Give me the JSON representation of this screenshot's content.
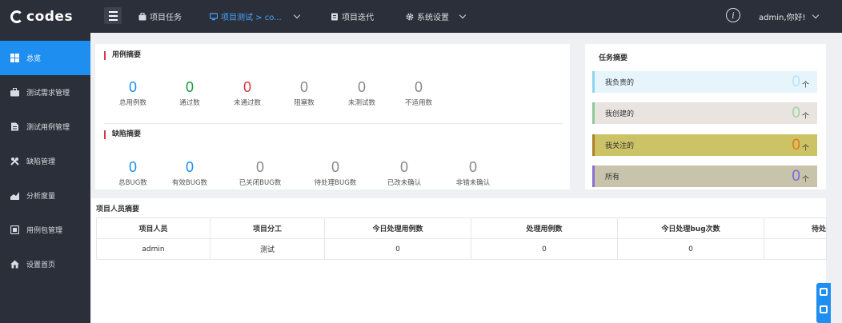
{
  "app": {
    "logo_text": "codes"
  },
  "topnav": {
    "items": [
      {
        "label": "项目任务",
        "icon": "briefcase-icon"
      },
      {
        "label": "项目测试 > co...",
        "icon": "monitor-icon",
        "active": true
      },
      {
        "label": "项目迭代",
        "icon": "document-icon"
      },
      {
        "label": "系统设置",
        "icon": "gear-icon"
      }
    ],
    "user_label": "admin,你好!"
  },
  "sidebar": {
    "items": [
      {
        "label": "总览",
        "icon": "dashboard-icon",
        "active": true
      },
      {
        "label": "测试需求管理",
        "icon": "briefcase-icon"
      },
      {
        "label": "测试用例管理",
        "icon": "file-icon"
      },
      {
        "label": "缺陷管理",
        "icon": "tools-icon"
      },
      {
        "label": "分析度量",
        "icon": "chart-icon"
      },
      {
        "label": "用例包管理",
        "icon": "package-icon"
      },
      {
        "label": "设置首页",
        "icon": "home-icon"
      }
    ]
  },
  "case_summary": {
    "title": "用例摘要",
    "stats": [
      {
        "value": "0",
        "label": "总用例数",
        "color": "#1f8ef1"
      },
      {
        "value": "0",
        "label": "通过数",
        "color": "#1a9c3e"
      },
      {
        "value": "0",
        "label": "未通过数",
        "color": "#d9363e"
      },
      {
        "value": "0",
        "label": "阻塞数",
        "color": "#888888"
      },
      {
        "value": "0",
        "label": "未测试数",
        "color": "#888888"
      },
      {
        "value": "0",
        "label": "不适用数",
        "color": "#888888"
      }
    ]
  },
  "bug_summary": {
    "title": "缺陷摘要",
    "stats": [
      {
        "value": "0",
        "label": "总BUG数",
        "color": "#1f8ef1"
      },
      {
        "value": "0",
        "label": "有效BUG数",
        "color": "#1f8ef1"
      },
      {
        "value": "0",
        "label": "已关闭BUG数",
        "color": "#888888"
      },
      {
        "value": "0",
        "label": "待处理BUG数",
        "color": "#888888"
      },
      {
        "value": "0",
        "label": "已改未确认",
        "color": "#888888"
      },
      {
        "value": "0",
        "label": "非错未确认",
        "color": "#888888"
      }
    ]
  },
  "task_summary": {
    "title": "任务摘要",
    "unit": "个",
    "rows": [
      {
        "label": "我负责的",
        "value": "0",
        "bg": "#e6f4fb",
        "border": "#8fd3ee",
        "num_color": "#b8e3f5"
      },
      {
        "label": "我创建的",
        "value": "0",
        "bg": "#e9e4e0",
        "border": "#8fc89a",
        "num_color": "#9fd4a8"
      },
      {
        "label": "我关注的",
        "value": "0",
        "bg": "#ccc266",
        "border": "#b0802a",
        "num_color": "#e07d10"
      },
      {
        "label": "所有",
        "value": "0",
        "bg": "#c7c4ab",
        "border": "#8a6fd0",
        "num_color": "#7b68e0"
      }
    ]
  },
  "members": {
    "title": "项目人员摘要",
    "columns": [
      "项目人员",
      "项目分工",
      "今日处理用例数",
      "处理用例数",
      "今日处理bug次数",
      "待处"
    ],
    "rows": [
      [
        "admin",
        "测试",
        "0",
        "0",
        "0",
        ""
      ]
    ]
  }
}
